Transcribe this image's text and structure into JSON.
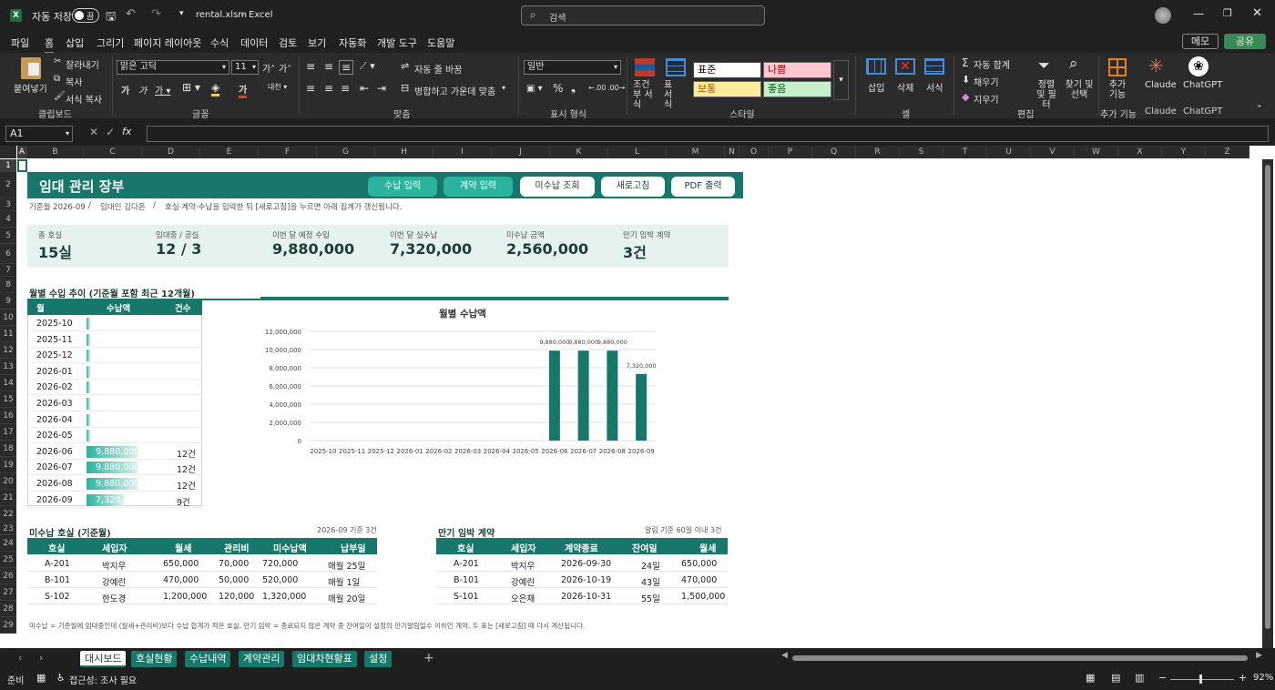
{
  "window": {
    "autosave_label": "자동 저장",
    "autosave_state": "끔",
    "file_name": "rental.xlsm",
    "app_name": "Excel",
    "search_placeholder": "검색"
  },
  "menu": [
    "파일",
    "홈",
    "삽입",
    "그리기",
    "페이지 레이아웃",
    "수식",
    "데이터",
    "검토",
    "보기",
    "자동화",
    "개발 도구",
    "도움말"
  ],
  "menu_right": {
    "memo": "메모",
    "share": "공유"
  },
  "ribbon": {
    "paste": "붙여넣기",
    "cut": "잘라내기",
    "copy": "복사",
    "format_painter": "서식 복사",
    "clipboard": "클립보드",
    "font_name": "맑은 고딕",
    "font_size": "11",
    "font_group": "글꼴",
    "wrap": "자동 줄 바꿈",
    "merge": "병합하고 가운데 맞춤",
    "align_group": "맞춤",
    "number_format": "일반",
    "number_group": "표시 형식",
    "cond_format": "조건부 서식",
    "table_format": "표 서식",
    "style_normal": "표준",
    "style_bad": "나쁨",
    "style_neutral": "보통",
    "style_good": "좋음",
    "style_group": "스타일",
    "insert": "삽입",
    "delete": "삭제",
    "format": "서식",
    "cells_group": "셀",
    "autosum": "자동 합계",
    "fill": "채우기",
    "clear": "지우기",
    "sort": "정렬 및 필터",
    "find": "찾기 및 선택",
    "edit_group": "편집",
    "addin": "추가 기능",
    "addin_group": "추가 기능",
    "claude": "Claude",
    "chatgpt": "ChatGPT"
  },
  "formula_bar": {
    "cell_ref": "A1",
    "fx": "fx",
    "value": ""
  },
  "columns": [
    "A",
    "B",
    "C",
    "D",
    "E",
    "F",
    "G",
    "H",
    "I",
    "J",
    "K",
    "L",
    "M",
    "N",
    "O",
    "P",
    "Q",
    "R",
    "S",
    "T",
    "U",
    "V",
    "W",
    "X",
    "Y",
    "Z"
  ],
  "rows": [
    "1",
    "2",
    "3",
    "4",
    "5",
    "6",
    "7",
    "8",
    "9",
    "10",
    "11",
    "12",
    "13",
    "14",
    "15",
    "16",
    "17",
    "18",
    "19",
    "20",
    "21",
    "22",
    "23",
    "24",
    "25",
    "26",
    "27",
    "28",
    "29"
  ],
  "dashboard": {
    "title": "임대 관리 장부",
    "buttons": [
      "수납 입력",
      "계약 입력",
      "미수납 조회",
      "새로고침",
      "PDF 출력"
    ],
    "subtitle_month": "기준월 2026-09",
    "subtitle_sep1": "/",
    "subtitle_owner": "임대인 김다온",
    "subtitle_sep2": "/",
    "subtitle_note": "호실·계약·수납을 입력한 뒤 [새로고침]을 누르면 아래 집계가 갱신됩니다.",
    "kpis": [
      {
        "label": "총 호실",
        "value": "15실"
      },
      {
        "label": "임대중 / 공실",
        "value": "12 / 3"
      },
      {
        "label": "이번 달 예정 수입",
        "value": "9,880,000"
      },
      {
        "label": "이번 달 실수납",
        "value": "7,320,000"
      },
      {
        "label": "미수납 금액",
        "value": "2,560,000"
      },
      {
        "label": "만기 임박 계약",
        "value": "3건"
      }
    ],
    "trend_title": "월별 수입 추이 (기준월 포함 최근 12개월)",
    "trend_headers": [
      "월",
      "수납액",
      "건수"
    ],
    "trend_rows": [
      {
        "month": "2025-10",
        "amount": "",
        "count": "",
        "frac": 0.0
      },
      {
        "month": "2025-11",
        "amount": "",
        "count": "",
        "frac": 0.0
      },
      {
        "month": "2025-12",
        "amount": "",
        "count": "",
        "frac": 0.0
      },
      {
        "month": "2026-01",
        "amount": "",
        "count": "",
        "frac": 0.0
      },
      {
        "month": "2026-02",
        "amount": "",
        "count": "",
        "frac": 0.0
      },
      {
        "month": "2026-03",
        "amount": "",
        "count": "",
        "frac": 0.0
      },
      {
        "month": "2026-04",
        "amount": "",
        "count": "",
        "frac": 0.0
      },
      {
        "month": "2026-05",
        "amount": "",
        "count": "",
        "frac": 0.0
      },
      {
        "month": "2026-06",
        "amount": "9,880,000",
        "count": "12건",
        "frac": 1.0
      },
      {
        "month": "2026-07",
        "amount": "9,880,000",
        "count": "12건",
        "frac": 1.0
      },
      {
        "month": "2026-08",
        "amount": "9,880,000",
        "count": "12건",
        "frac": 1.0
      },
      {
        "month": "2026-09",
        "amount": "7,320,000",
        "count": "9건",
        "frac": 0.741
      }
    ],
    "unpaid_title": "미수납 호실 (기준월)",
    "unpaid_note": "2026-09 기준 3건",
    "unpaid_headers": [
      "호실",
      "세입자",
      "월세",
      "관리비",
      "미수납액",
      "납부일"
    ],
    "unpaid_rows": [
      [
        "A-201",
        "박지우",
        "650,000",
        "70,000",
        "720,000",
        "매월 25일"
      ],
      [
        "B-101",
        "강예린",
        "470,000",
        "50,000",
        "520,000",
        "매월 1일"
      ],
      [
        "S-102",
        "한도경",
        "1,200,000",
        "120,000",
        "1,320,000",
        "매월 20일"
      ]
    ],
    "expiry_title": "만기 임박 계약",
    "expiry_note": "알림 기준 60일 이내 3건",
    "expiry_headers": [
      "호실",
      "세입자",
      "계약종료",
      "잔여일",
      "월세"
    ],
    "expiry_rows": [
      [
        "A-201",
        "박지우",
        "2026-09-30",
        "24일",
        "650,000"
      ],
      [
        "B-101",
        "강예린",
        "2026-10-19",
        "43일",
        "470,000"
      ],
      [
        "S-101",
        "오은채",
        "2026-10-31",
        "55일",
        "1,500,000"
      ]
    ],
    "footnote": "미수납 = 기준월에 임대중인데 (월세+관리비)보다 수납 합계가 적은 호실.  만기 임박 = 종료되지 않은 계약 중 잔여일이 설정의 만기알림일수 이하인 계약.  두 표는 [새로고침] 때 다시 계산됩니다."
  },
  "chart_data": {
    "type": "bar",
    "title": "월별 수납액",
    "categories": [
      "2025-10",
      "2025-11",
      "2025-12",
      "2026-01",
      "2026-02",
      "2026-03",
      "2026-04",
      "2026-05",
      "2026-06",
      "2026-07",
      "2026-08",
      "2026-09"
    ],
    "values": [
      0,
      0,
      0,
      0,
      0,
      0,
      0,
      0,
      9880000,
      9880000,
      9880000,
      7320000
    ],
    "data_labels": [
      "",
      "",
      "",
      "",
      "",
      "",
      "",
      "",
      "9,880,000",
      "9,880,000",
      "9,880,000",
      "7,320,000"
    ],
    "y_ticks": [
      "12,000,000",
      "10,000,000",
      "8,000,000",
      "6,000,000",
      "4,000,000",
      "2,000,000",
      "0"
    ],
    "ylim": [
      0,
      12000000
    ],
    "color": "#17776b",
    "grid": true
  },
  "sheet_tabs": [
    "대시보드",
    "호실현황",
    "수납내역",
    "계약관리",
    "임대차현황표",
    "설정"
  ],
  "status": {
    "ready": "준비",
    "accessibility": "접근성: 조사 필요",
    "zoom": "92%"
  }
}
